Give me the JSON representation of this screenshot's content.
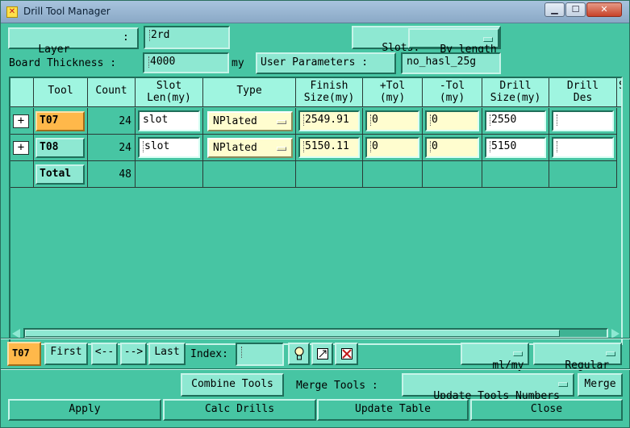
{
  "window": {
    "title": "Drill Tool Manager",
    "minimize": "▁",
    "maximize": "☐",
    "close": "✕"
  },
  "header": {
    "layer_label": "Layer",
    "layer_colon": ":",
    "layer_value": "2rd",
    "slots_label": "Slots:",
    "slots_value": "By length",
    "thickness_label": "Board Thickness :",
    "thickness_value": "4000",
    "thickness_unit": "my",
    "user_params_label": "User Parameters :",
    "user_params_value": "no_hasl_25g"
  },
  "table": {
    "columns": [
      {
        "line1": "Tool",
        "line2": ""
      },
      {
        "line1": "Count",
        "line2": ""
      },
      {
        "line1": "Slot",
        "line2": "Len(my)"
      },
      {
        "line1": "Type",
        "line2": ""
      },
      {
        "line1": "Finish",
        "line2": "Size(my)"
      },
      {
        "line1": "+Tol",
        "line2": "(my)"
      },
      {
        "line1": "-Tol",
        "line2": "(my)"
      },
      {
        "line1": "Drill",
        "line2": "Size(my)"
      },
      {
        "line1": "Drill",
        "line2": "Des"
      },
      {
        "line1": "S",
        "line2": ""
      }
    ],
    "rows": [
      {
        "tool": "T07",
        "count": "24",
        "slot_len": "slot",
        "type": "NPlated",
        "finish": "2549.91",
        "ptol": "0",
        "mtol": "0",
        "drill_size": "2550",
        "drill_des": ""
      },
      {
        "tool": "T08",
        "count": "24",
        "slot_len": "slot",
        "type": "NPlated",
        "finish": "5150.11",
        "ptol": "0",
        "mtol": "0",
        "drill_size": "5150",
        "drill_des": ""
      }
    ],
    "total_label": "Total",
    "total_count": "48"
  },
  "nav": {
    "current_tool": "T07",
    "first": "First",
    "prev": "<--",
    "next": "-->",
    "last": "Last",
    "index_label": "Index:",
    "index_value": "",
    "units": "ml/my",
    "mode": "Regular"
  },
  "actions": {
    "combine": "Combine Tools",
    "merge_label": "Merge Tools :",
    "update_numbers": "Update Tools Numbers",
    "merge": "Merge",
    "apply": "Apply",
    "calc": "Calc Drills",
    "update_table": "Update Table",
    "close": "Close"
  },
  "colors": {
    "panel": "#47c5a3",
    "field": "#8ee8d2",
    "header": "#9ff5e0",
    "selected": "#ffb84a",
    "edit": "#fffdcf"
  }
}
